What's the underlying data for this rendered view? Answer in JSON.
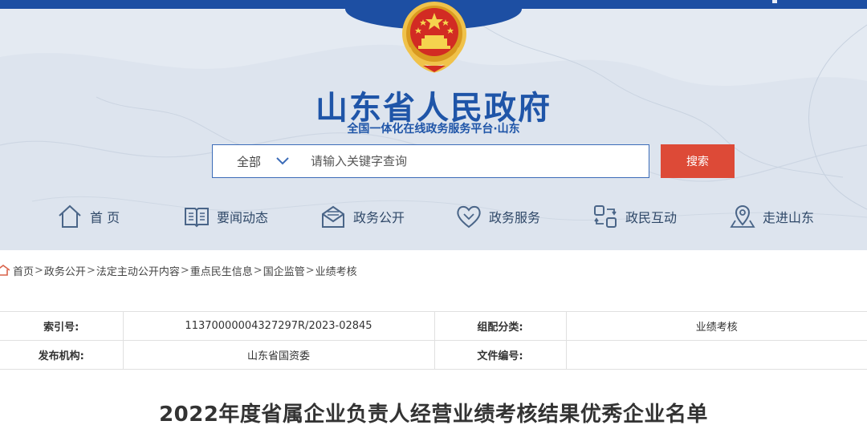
{
  "site": {
    "title": "山东省人民政府",
    "subtitle": "全国一体化在线政务服务平台·山东"
  },
  "search": {
    "scope_label": "全部",
    "placeholder": "请输入关键字查询",
    "button_label": "搜索"
  },
  "nav": {
    "items": [
      {
        "label": "首 页",
        "icon": "home-icon"
      },
      {
        "label": "要闻动态",
        "icon": "news-book-icon"
      },
      {
        "label": "政务公开",
        "icon": "mail-icon"
      },
      {
        "label": "政务服务",
        "icon": "heart-icon"
      },
      {
        "label": "政民互动",
        "icon": "interaction-icon"
      },
      {
        "label": "走进山东",
        "icon": "location-icon"
      }
    ]
  },
  "breadcrumb": {
    "items": [
      "首页",
      "政务公开",
      "法定主动公开内容",
      "重点民生信息",
      "国企监管",
      "业绩考核"
    ],
    "separator": ">"
  },
  "meta": {
    "index_label": "索引号:",
    "index_value": "11370000004327297R/2023-02845",
    "category_label": "组配分类:",
    "category_value": "业绩考核",
    "publisher_label": "发布机构:",
    "publisher_value": "山东省国资委",
    "doc_no_label": "文件编号:",
    "doc_no_value": ""
  },
  "article": {
    "title": "2022年度省属企业负责人经营业绩考核结果优秀企业名单"
  },
  "colors": {
    "brand_blue": "#1f55a8",
    "header_blue": "#1d4fa3",
    "search_red": "#dd4a37",
    "hero_bg": "#e4eaf2"
  }
}
